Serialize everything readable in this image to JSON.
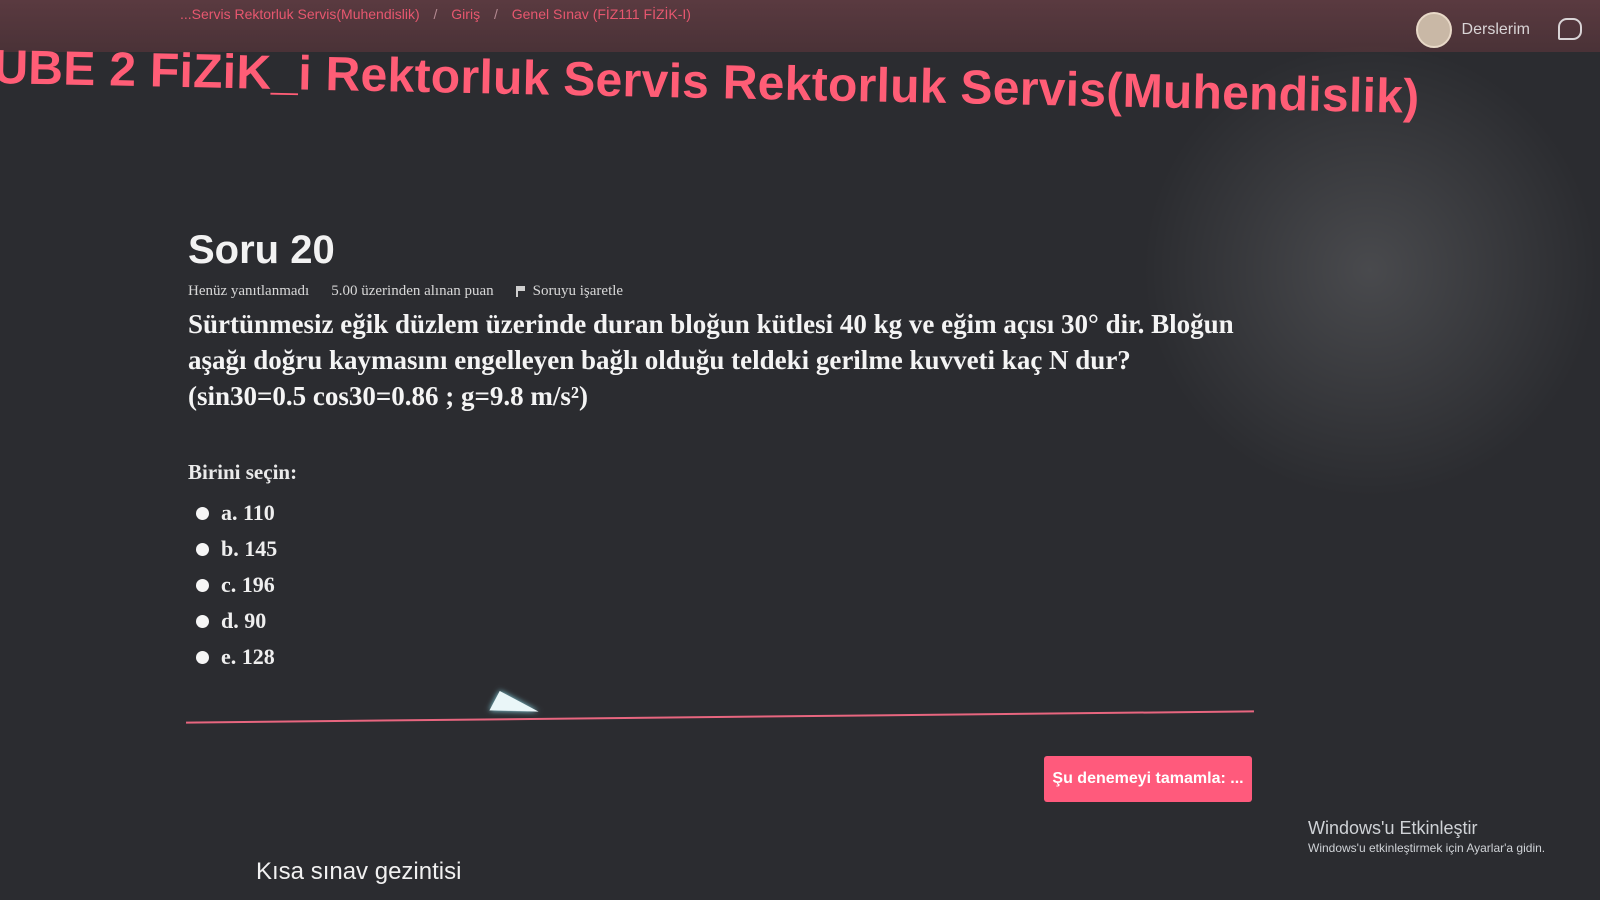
{
  "topbar": {
    "breadcrumb": [
      "...Servis Rektorluk Servis(Muhendislik)",
      "Giriş",
      "Genel Sınav (FİZ111 FİZİK-I)"
    ],
    "user_menu_label": "Derslerim"
  },
  "course": {
    "title": "UBE 2 FiZiK_i Rektorluk Servis Rektorluk Servis(Muhendislik)"
  },
  "question": {
    "number": "Soru 20",
    "status": "Henüz yanıtlanmadı",
    "points": "5.00 üzerinden alınan puan",
    "flag_label": "Soruyu işaretle",
    "text_lines": [
      "Sürtünmesiz eğik düzlem üzerinde duran bloğun kütlesi 40 kg ve eğim açısı 30° dir. Bloğun",
      "aşağı doğru kaymasını engelleyen bağlı olduğu teldeki gerilme kuvveti kaç N dur?",
      "(sin30=0.5 cos30=0.86 ;  g=9.8 m/s²)"
    ],
    "prompt": "Birini seçin:",
    "answers": [
      "a. 110",
      "b. 145",
      "c. 196",
      "d. 90",
      "e. 128"
    ]
  },
  "actions": {
    "finish_label": "Şu denemeyi tamamla: ..."
  },
  "navigation": {
    "title": "Kısa sınav gezintisi"
  },
  "windows_activation": {
    "title": "Windows'u Etkinleştir",
    "subtitle": "Windows'u etkinleştirmek için Ayarlar'a gidin."
  },
  "colors": {
    "accent": "#ff5d76",
    "button": "#ff5a7c",
    "background": "#2b2c30"
  }
}
